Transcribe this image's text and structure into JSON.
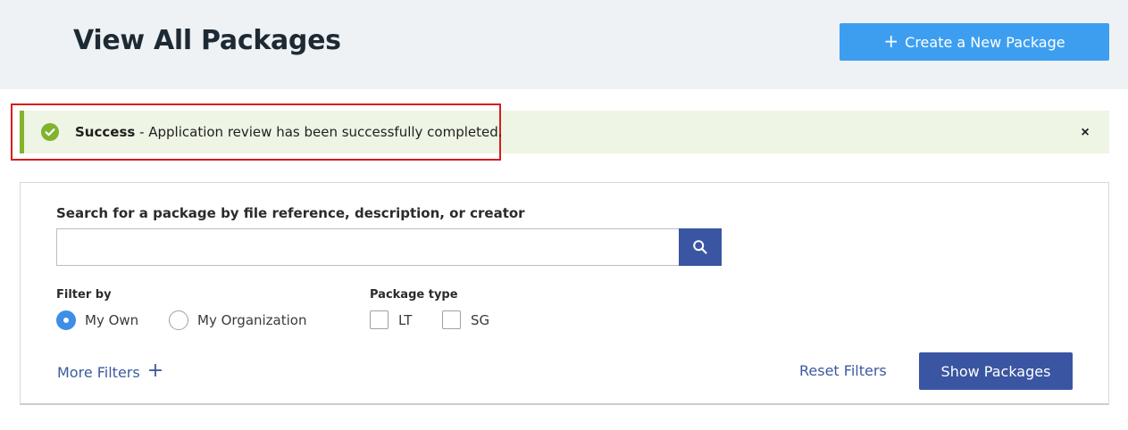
{
  "header": {
    "title": "View All Packages",
    "create_button_label": "Create a New Package",
    "create_button_icon": "plus-icon"
  },
  "alert": {
    "status": "Success",
    "message": " - Application review has been successfully completed.",
    "icon": "check-circle-icon",
    "close_glyph": "×",
    "accent_color": "#82b52a",
    "background_color": "#eef5e5",
    "highlight_color": "#d71d1d"
  },
  "search": {
    "label": "Search for a package by file reference, description, or creator",
    "value": "",
    "placeholder": ""
  },
  "filters": {
    "filter_by_label": "Filter by",
    "filter_by_options": [
      {
        "label": "My Own",
        "checked": true
      },
      {
        "label": "My Organization",
        "checked": false
      }
    ],
    "package_type_label": "Package type",
    "package_type_options": [
      {
        "label": "LT",
        "checked": false
      },
      {
        "label": "SG",
        "checked": false
      }
    ]
  },
  "actions": {
    "more_filters_label": "More Filters",
    "reset_filters_label": "Reset Filters",
    "show_packages_label": "Show Packages"
  },
  "colors": {
    "primary_button": "#3a55a2",
    "create_button": "#3d9ef0",
    "link": "#3d5a9e",
    "radio_checked": "#3d8ee6"
  }
}
